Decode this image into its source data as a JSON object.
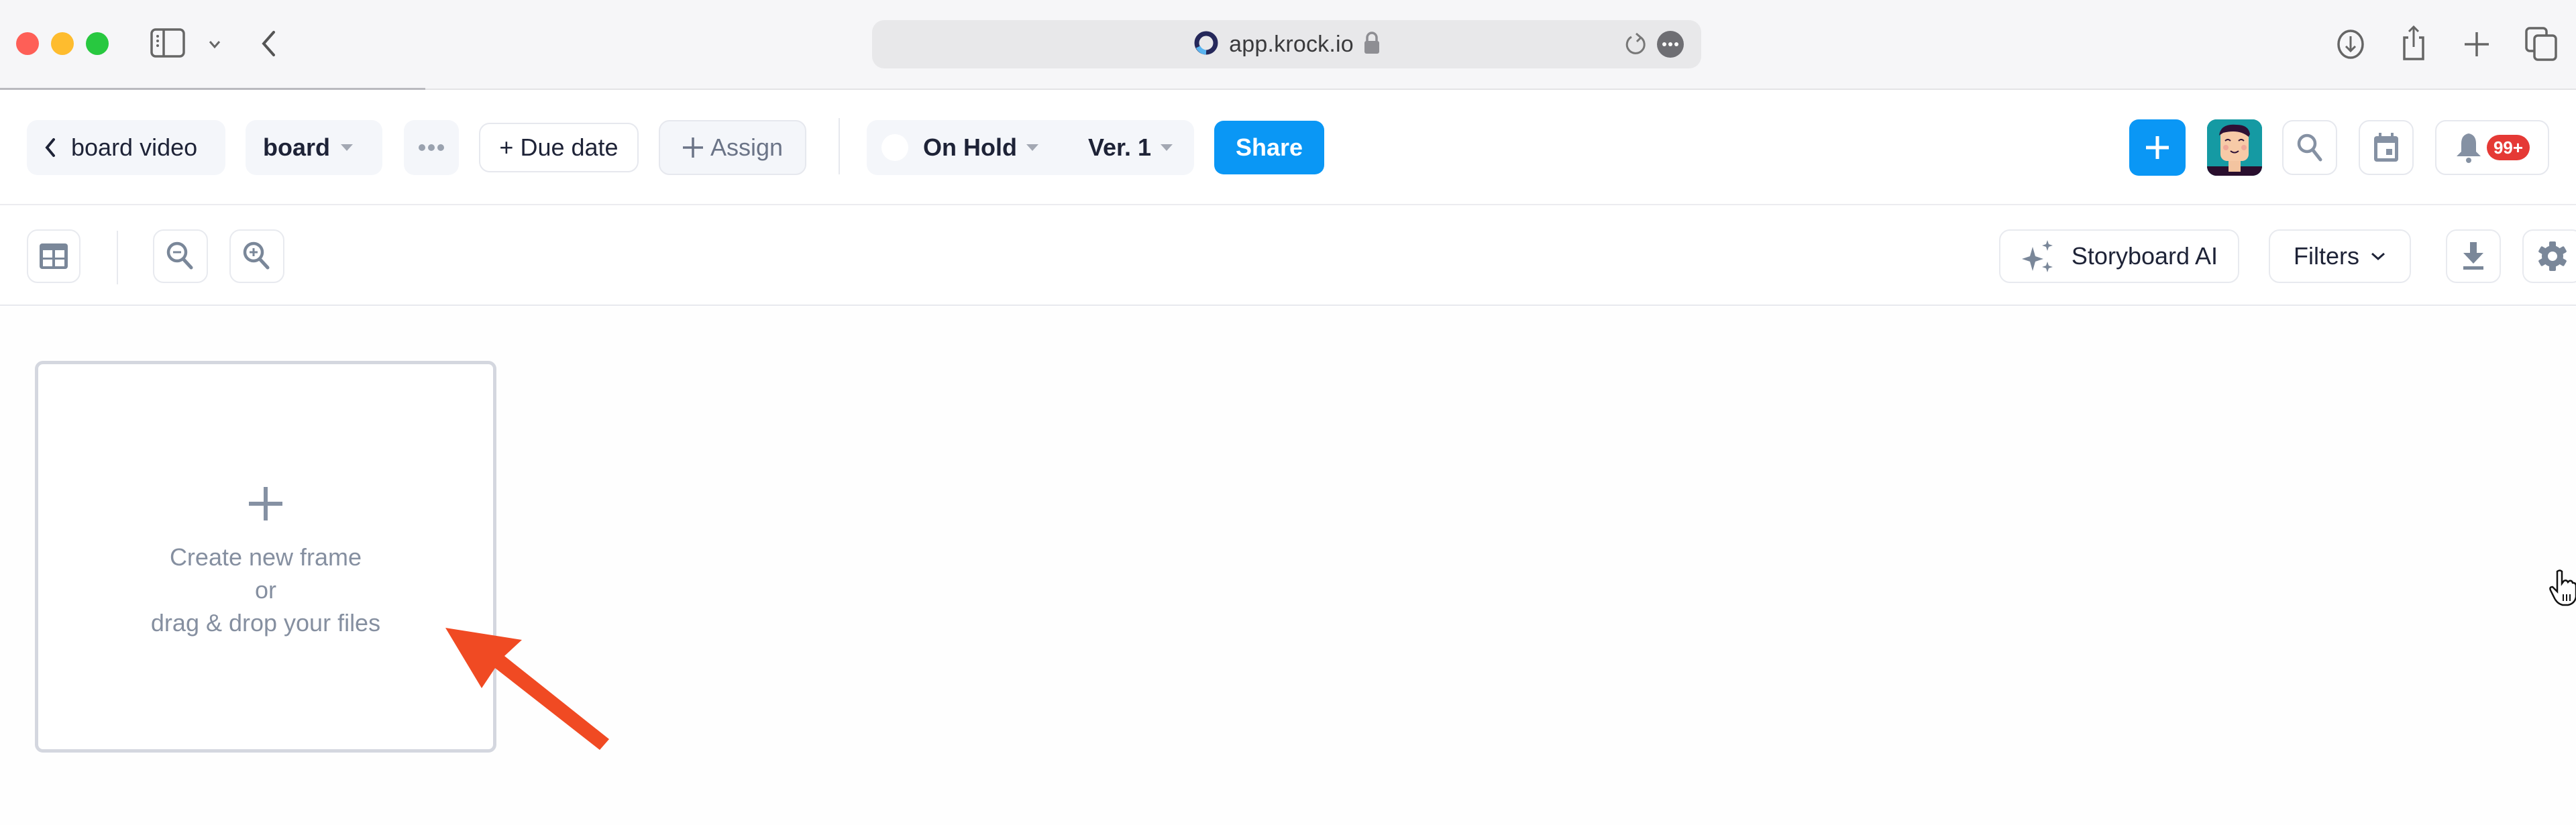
{
  "browser": {
    "url": "app.krock.io",
    "load_progress_percent": 16.5,
    "icons": {
      "sidebar": "sidebar-toggle-icon",
      "back": "chevron-left-icon",
      "site": "krock-logo-icon",
      "lock": "lock-icon",
      "reload": "reload-icon",
      "page_menu": "ellipsis-icon",
      "download": "download-circle-icon",
      "share": "share-icon",
      "new_tab": "plus-icon",
      "tabs": "tab-overview-icon"
    }
  },
  "header": {
    "back_label": "board video",
    "board_label": "board",
    "more_label": "•••",
    "due_date_label": "+ Due date",
    "assign_label": "Assign",
    "status": {
      "label": "On Hold",
      "dot_color": "#ffffff"
    },
    "version": {
      "label": "Ver. 1"
    },
    "share_label": "Share",
    "notifications_badge": "99+",
    "accent_color": "#0a97f5",
    "badge_color": "#e53935"
  },
  "toolbar": {
    "storyboard_ai_label": "Storyboard AI",
    "filters_label": "Filters"
  },
  "canvas": {
    "new_frame_card": {
      "line1": "Create new frame",
      "line2": "or",
      "line3": "drag & drop your files"
    },
    "annotation_arrow_color": "#f04a23"
  }
}
